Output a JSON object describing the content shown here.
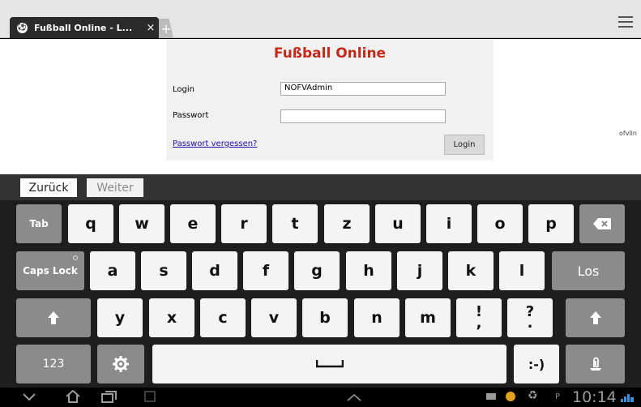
{
  "browser": {
    "tab_title": "Fußball Online - L...",
    "close_glyph": "×",
    "new_tab_glyph": "+"
  },
  "page": {
    "site_title": "Fußball Online",
    "login_label": "Login",
    "login_value": "NOFVAdmin",
    "password_label": "Passwort",
    "password_value": "",
    "forgot_link": "Passwort vergessen?",
    "login_button": "Login",
    "right_text": "ofvlin"
  },
  "nav": {
    "back_label": "Zurück",
    "next_label": "Weiter"
  },
  "keyboard": {
    "row1": {
      "tab": "Tab",
      "keys": [
        "q",
        "w",
        "e",
        "r",
        "t",
        "z",
        "u",
        "i",
        "o",
        "p"
      ],
      "backspace_icon": "backspace-icon"
    },
    "row2": {
      "capslock": "Caps Lock",
      "keys": [
        "a",
        "s",
        "d",
        "f",
        "g",
        "h",
        "j",
        "k",
        "l"
      ],
      "enter": "Los"
    },
    "row3": {
      "shift_icon": "shift-arrow-icon",
      "keys": [
        "y",
        "x",
        "c",
        "v",
        "b",
        "n",
        "m"
      ],
      "excl_top": "!",
      "excl_bottom": ",",
      "quest_top": "?",
      "quest_bottom": "."
    },
    "row4": {
      "numbers": "123",
      "settings_icon": "gear-icon",
      "space_icon": "space-icon",
      "smiley": ":-)",
      "clip_icon": "clip-icon"
    }
  },
  "system": {
    "clock": "10:14",
    "status_letter": "P",
    "icons": [
      "back-icon",
      "home-icon",
      "recent-apps-icon",
      "screenshot-icon",
      "up-chevron-icon",
      "notification-icon",
      "recycle-icon",
      "wifi-icon"
    ]
  },
  "colors": {
    "site_title": "#c42a1c",
    "link": "#1a0dab",
    "dark_key": "#8b8b8b",
    "light_key": "#f4f4f4"
  }
}
